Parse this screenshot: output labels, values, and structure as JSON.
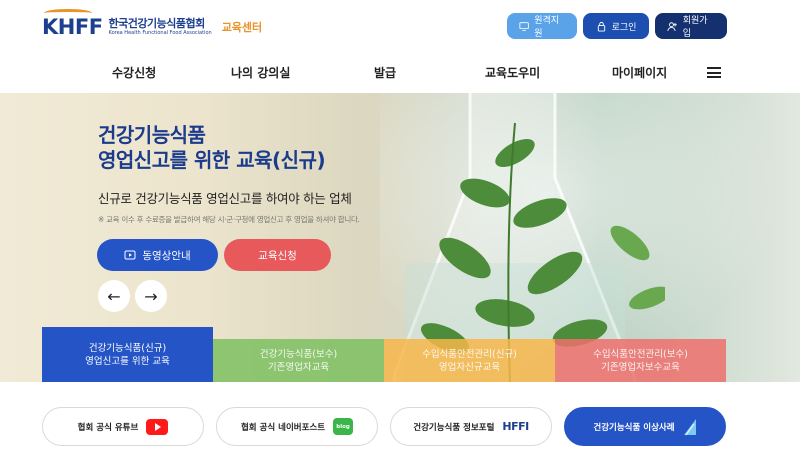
{
  "header": {
    "logo_mark": "KHFF",
    "logo_ko": "한국건강기능식품협회",
    "logo_en": "Korea Health Functional Food Association",
    "logo_edu": "교육센터",
    "buttons": {
      "remote": "원격지원",
      "login": "로그인",
      "join": "회원가입"
    }
  },
  "nav": {
    "items": [
      "수강신청",
      "나의 강의실",
      "발급",
      "교육도우미",
      "마이페이지"
    ],
    "menu_icon": "hamburger-icon"
  },
  "hero": {
    "title_line1": "건강기능식품",
    "title_line2": "영업신고를 위한 교육(신규)",
    "subtitle": "신규로 건강기능식품 영업신고를 하여야 하는 업체",
    "note": "※ 교육 이수 후 수료증을 발급하여 해당 시·군·구청에 영업신고 후 영업을 하셔야 합니다.",
    "video_button": "동영상안내",
    "apply_button": "교육신청",
    "prev": "←",
    "next": "→"
  },
  "tabs": [
    {
      "line1": "건강기능식품(신규)",
      "line2": "영업신고를 위한 교육",
      "active": true
    },
    {
      "line1": "건강기능식품(보수)",
      "line2": "기존영업자교육",
      "active": false
    },
    {
      "line1": "수입식품안전관리(신규)",
      "line2": "영업자신규교육",
      "active": false
    },
    {
      "line1": "수입식품안전관리(보수)",
      "line2": "기존영업자보수교육",
      "active": false
    }
  ],
  "links": {
    "youtube": "협회 공식 유튜브",
    "blog": "협회 공식 네이버포스트",
    "blog_badge": "blog",
    "portal": "건강기능식품 정보포털",
    "portal_logo": "HFFI",
    "case": "건강기능식품 이상사례"
  },
  "colors": {
    "primary": "#2554c7",
    "navy": "#14306e",
    "orange": "#e9932a",
    "red": "#e8595c",
    "green": "#7dc060",
    "yellow": "#f7b64a",
    "pink": "#ee706c"
  }
}
